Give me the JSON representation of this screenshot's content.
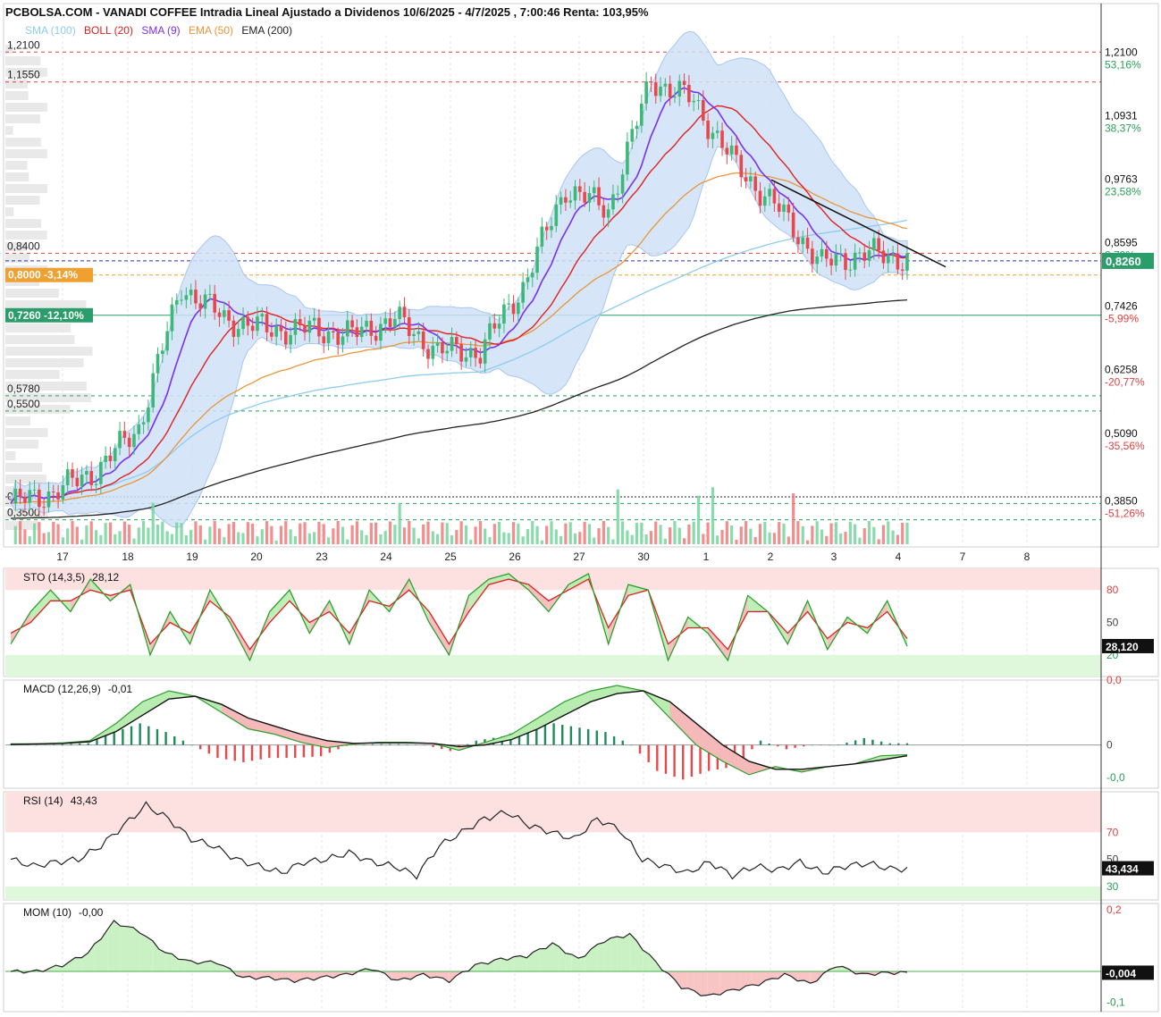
{
  "header": {
    "title": "PCBOLSA.COM - VANADI COFFEE Intradia Lineal Ajustado a Dividenos 10/6/2025 - 4/7/2025 , 7:00:46 Renta: 103,95%",
    "legend": [
      {
        "label": "SMA (100)",
        "color": "#8ecbf0"
      },
      {
        "label": "BOLL (20)",
        "color": "#e02020"
      },
      {
        "label": "SMA (9)",
        "color": "#7b2ff0"
      },
      {
        "label": "EMA (50)",
        "color": "#e8963a"
      },
      {
        "label": "EMA (200)",
        "color": "#222222"
      }
    ]
  },
  "chart_data": [
    {
      "type": "candlestick",
      "panel": "price",
      "x_labels": [
        "17",
        "18",
        "19",
        "20",
        "23",
        "24",
        "25",
        "26",
        "27",
        "30",
        "1",
        "2",
        "3",
        "4",
        "7",
        "8"
      ],
      "ylim": [
        0.3,
        1.24
      ],
      "right_axis": [
        {
          "price": "1,2100",
          "pct": "53,16%",
          "pct_color": "#2aa05a",
          "value": 1.21
        },
        {
          "price": "1,0931",
          "pct": "38,37%",
          "pct_color": "#2aa05a",
          "value": 1.0931
        },
        {
          "price": "0,9763",
          "pct": "23,58%",
          "pct_color": "#2aa05a",
          "value": 0.9763
        },
        {
          "price": "0,8595",
          "pct": "8,79%",
          "pct_color": "#2aa05a",
          "value": 0.8595
        },
        {
          "price": "0,7426",
          "pct": "-5,99%",
          "pct_color": "#e04040",
          "value": 0.7426
        },
        {
          "price": "0,6258",
          "pct": "-20,77%",
          "pct_color": "#e04040",
          "value": 0.6258
        },
        {
          "price": "0,5090",
          "pct": "-35,56%",
          "pct_color": "#e04040",
          "value": 0.509
        },
        {
          "price": "0,3850",
          "pct": "-51,26%",
          "pct_color": "#e04040",
          "value": 0.385
        }
      ],
      "current_price": {
        "label": "0,8260",
        "value": 0.826
      },
      "levels": [
        {
          "label": "1,2100",
          "value": 1.21,
          "color": "#e04040",
          "style": "dash"
        },
        {
          "label": "1,1550",
          "value": 1.155,
          "color": "#e04040",
          "style": "dash"
        },
        {
          "label": "0,8400",
          "value": 0.84,
          "color": "#e04040",
          "style": "dash"
        },
        {
          "label": "0,5780",
          "value": 0.578,
          "color": "#2aa05a",
          "style": "dash"
        },
        {
          "label": "0,5500",
          "value": 0.55,
          "color": "#2aa05a",
          "style": "dash"
        },
        {
          "label": "0,3800",
          "value": 0.38,
          "color": "#2aa05a",
          "style": "dash"
        },
        {
          "label": "0,3500",
          "value": 0.35,
          "color": "#2aa05a",
          "style": "dash"
        }
      ],
      "tags": [
        {
          "label": "0,8000  -3,14%",
          "value": 0.8,
          "color": "#f0a030"
        },
        {
          "label": "0,7260  -12,10%",
          "value": 0.726,
          "color": "#2a9d6a"
        }
      ],
      "trendline": [
        {
          "x": 0.46,
          "y": 0.975
        },
        {
          "x": 0.46,
          "y": 0.82
        }
      ],
      "ohlc_key_points": [
        [
          0.4,
          0.38
        ],
        [
          0.38,
          0.4
        ],
        [
          0.42,
          0.44
        ],
        [
          0.48,
          0.52
        ],
        [
          0.7,
          0.78
        ],
        [
          0.76,
          0.72
        ],
        [
          0.77,
          0.7
        ],
        [
          0.68,
          0.7
        ],
        [
          0.68,
          0.69
        ],
        [
          0.7,
          0.72
        ],
        [
          0.71,
          0.66
        ],
        [
          0.65,
          0.66
        ],
        [
          0.66,
          0.78
        ],
        [
          0.8,
          0.96
        ],
        [
          0.95,
          0.92
        ],
        [
          0.95,
          1.16
        ],
        [
          1.16,
          1.12
        ],
        [
          1.08,
          1.0
        ],
        [
          0.98,
          0.92
        ],
        [
          0.9,
          0.82
        ],
        [
          0.86,
          0.84
        ],
        [
          0.84,
          0.83
        ]
      ]
    },
    {
      "type": "line",
      "panel": "STO",
      "title": "STO (14,3,5)",
      "value_label": "28,12",
      "last_label": "28,120",
      "ylim": [
        0,
        100
      ],
      "zones": [
        {
          "from": 80,
          "to": 100,
          "color": "#fde0e0"
        },
        {
          "from": 0,
          "to": 20,
          "color": "#dff8dc"
        }
      ],
      "ticks": [
        {
          "label": "80",
          "value": 80,
          "color": "#e04040"
        },
        {
          "label": "50",
          "value": 50,
          "color": "#444444"
        },
        {
          "label": "20",
          "value": 20,
          "color": "#2aa05a"
        }
      ],
      "k": [
        30,
        60,
        80,
        60,
        90,
        70,
        85,
        20,
        60,
        30,
        80,
        50,
        15,
        60,
        80,
        40,
        70,
        30,
        80,
        60,
        90,
        50,
        20,
        75,
        90,
        95,
        80,
        60,
        85,
        95,
        30,
        85,
        80,
        15,
        55,
        40,
        15,
        75,
        60,
        30,
        70,
        25,
        55,
        40,
        70,
        28
      ],
      "d": [
        40,
        50,
        70,
        70,
        80,
        75,
        80,
        30,
        50,
        40,
        70,
        55,
        25,
        50,
        70,
        50,
        60,
        40,
        70,
        65,
        80,
        60,
        30,
        60,
        85,
        90,
        85,
        70,
        80,
        90,
        45,
        75,
        80,
        30,
        45,
        45,
        25,
        60,
        60,
        40,
        60,
        35,
        50,
        45,
        60,
        35
      ]
    },
    {
      "type": "line",
      "panel": "MACD",
      "title": "MACD (12,26,9)",
      "value_label": "-0,01",
      "ylim": [
        -0.08,
        0.12
      ],
      "ticks": [
        {
          "label": "0,0",
          "value": 0.12,
          "color": "#e04040"
        },
        {
          "label": "0",
          "value": 0.0,
          "color": "#444444"
        },
        {
          "label": "-0,0",
          "value": -0.06,
          "color": "#2aa05a"
        }
      ],
      "macd": [
        0.002,
        0.002,
        0.004,
        0.008,
        0.04,
        0.08,
        0.1,
        0.09,
        0.06,
        0.03,
        0.02,
        0.005,
        -0.005,
        0.002,
        0.005,
        0.005,
        0.003,
        -0.01,
        0.005,
        0.02,
        0.05,
        0.08,
        0.1,
        0.11,
        0.1,
        0.05,
        0.0,
        -0.03,
        -0.055,
        -0.04,
        -0.05,
        -0.04,
        -0.035,
        -0.02,
        -0.018
      ],
      "signal": [
        0.001,
        0.002,
        0.003,
        0.006,
        0.025,
        0.055,
        0.085,
        0.09,
        0.075,
        0.05,
        0.035,
        0.02,
        0.008,
        0.003,
        0.004,
        0.004,
        0.003,
        -0.003,
        0.0,
        0.01,
        0.03,
        0.055,
        0.08,
        0.095,
        0.1,
        0.08,
        0.04,
        0.0,
        -0.03,
        -0.045,
        -0.045,
        -0.04,
        -0.035,
        -0.028,
        -0.02
      ]
    },
    {
      "type": "line",
      "panel": "RSI",
      "title": "RSI (14)",
      "value_label": "43,43",
      "last_label": "43,434",
      "ylim": [
        20,
        100
      ],
      "zones": [
        {
          "from": 70,
          "to": 100,
          "color": "#fde0e0"
        },
        {
          "from": 20,
          "to": 30,
          "color": "#dff8dc"
        }
      ],
      "ticks": [
        {
          "label": "70",
          "value": 70,
          "color": "#e04040"
        },
        {
          "label": "50",
          "value": 50,
          "color": "#444444"
        },
        {
          "label": "30",
          "value": 30,
          "color": "#2aa05a"
        }
      ],
      "values": [
        50,
        45,
        48,
        50,
        60,
        75,
        90,
        80,
        65,
        60,
        50,
        45,
        40,
        48,
        50,
        55,
        48,
        45,
        38,
        60,
        70,
        80,
        85,
        75,
        70,
        65,
        80,
        72,
        50,
        45,
        40,
        48,
        38,
        45,
        42,
        48,
        40,
        45,
        47,
        43
      ]
    },
    {
      "type": "area",
      "panel": "MOM",
      "title": "MOM (10)",
      "value_label": "-0,00",
      "last_label": "-0,004",
      "ylim": [
        -0.13,
        0.22
      ],
      "ticks": [
        {
          "label": "0,2",
          "value": 0.2,
          "color": "#e04040"
        },
        {
          "label": "-0,1",
          "value": -0.1,
          "color": "#2aa05a"
        }
      ],
      "values": [
        0.0,
        0.0,
        0.02,
        0.06,
        0.16,
        0.13,
        0.06,
        0.03,
        0.03,
        -0.02,
        -0.02,
        -0.03,
        -0.02,
        -0.01,
        0.01,
        -0.03,
        -0.01,
        -0.03,
        0.02,
        0.04,
        0.05,
        0.09,
        0.04,
        0.1,
        0.12,
        0.03,
        -0.05,
        -0.08,
        -0.06,
        -0.04,
        -0.01,
        -0.04,
        0.02,
        -0.01,
        -0.004
      ]
    }
  ],
  "colors": {
    "up": "#3cb878",
    "down": "#e8474b",
    "band": "#cfe0f7",
    "grid": "#e6e6e6"
  }
}
